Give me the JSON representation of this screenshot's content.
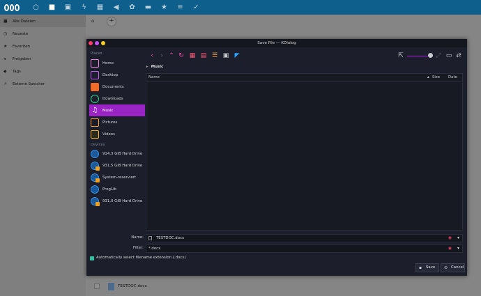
{
  "colors": {
    "topbar": "#0f5f8c",
    "accent": "#9a24c4",
    "dialog_bg": "#1c1f2b",
    "tb_close": "#ff3b6b",
    "tb_min": "#c050f0",
    "tb_max": "#f8d020"
  },
  "top_icons": [
    "dashboard-icon",
    "folder-icon",
    "image-icon",
    "activity-icon",
    "calendar-icon",
    "music-icon",
    "settings-icon",
    "briefcase-icon",
    "star-icon",
    "tasks-icon",
    "check-icon"
  ],
  "sidebar": {
    "items": [
      {
        "label": "Alle Dateien",
        "icon": "folder-icon",
        "glyph": "■"
      },
      {
        "label": "Neueste",
        "icon": "clock-icon",
        "glyph": "◷"
      },
      {
        "label": "Favoriten",
        "icon": "star-icon",
        "glyph": "★"
      },
      {
        "label": "Freigaben",
        "icon": "share-icon",
        "glyph": "◂"
      },
      {
        "label": "Tags",
        "icon": "tag-icon",
        "glyph": "◆"
      },
      {
        "label": "Externe Speicher",
        "icon": "external-icon",
        "glyph": "↗"
      }
    ]
  },
  "background_file": {
    "name": "TESTDOC.docx"
  },
  "dialog": {
    "title": "Save File — KDialog",
    "places_header": "Places",
    "devices_header": "Devices",
    "places": [
      {
        "label": "Home",
        "icon": "home"
      },
      {
        "label": "Desktop",
        "icon": "desk"
      },
      {
        "label": "Documents",
        "icon": "docs"
      },
      {
        "label": "Downloads",
        "icon": "down"
      },
      {
        "label": "Music",
        "icon": "mus",
        "selected": true
      },
      {
        "label": "Pictures",
        "icon": "pic"
      },
      {
        "label": "Videos",
        "icon": "vid"
      }
    ],
    "devices": [
      {
        "label": "914,3 GiB Hard Drive",
        "icon": "drvnb"
      },
      {
        "label": "931,5 GiB Hard Drive",
        "icon": "drv"
      },
      {
        "label": "System-reserviert",
        "icon": "drv"
      },
      {
        "label": "ProgLib",
        "icon": "drvnb"
      },
      {
        "label": "931,0 GiB Hard Drive",
        "icon": "drv"
      }
    ],
    "breadcrumb": "Music",
    "columns": {
      "name": "Name",
      "size": "Size",
      "date": "Date"
    },
    "name_label": "Name:",
    "name_value": "TESTDOC.docx",
    "filter_label": "Filter:",
    "filter_value": "*.docx",
    "auto_ext_label": "Automatically select filename extension (.docx)",
    "save_label": "Save",
    "cancel_label": "Cancel"
  }
}
